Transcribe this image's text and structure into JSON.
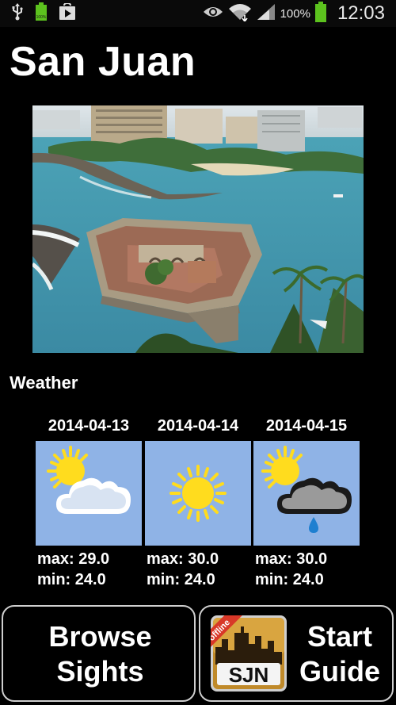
{
  "status_bar": {
    "battery_pct": "100%",
    "clock": "12:03",
    "icons": [
      "usb-icon",
      "battery-full-icon",
      "play-store-icon",
      "eye-icon",
      "wifi-icon",
      "signal-icon",
      "battery-icon"
    ]
  },
  "title": "San Juan",
  "weather": {
    "heading": "Weather",
    "days": [
      {
        "date": "2014-04-13",
        "max": "max: 29.0",
        "min": "min: 24.0",
        "icon": "partly-cloudy-icon"
      },
      {
        "date": "2014-04-14",
        "max": "max: 30.0",
        "min": "min: 24.0",
        "icon": "sunny-icon"
      },
      {
        "date": "2014-04-15",
        "max": "max: 30.0",
        "min": "min: 24.0",
        "icon": "sun-cloud-rain-icon"
      }
    ]
  },
  "buttons": {
    "browse": "Browse\nSights",
    "start": "Start\nGuide",
    "logo_text": "SJN",
    "logo_ribbon": "offline"
  },
  "colors": {
    "background": "#000000",
    "tile": "#8fb3e6",
    "battery": "#5cc21e"
  }
}
